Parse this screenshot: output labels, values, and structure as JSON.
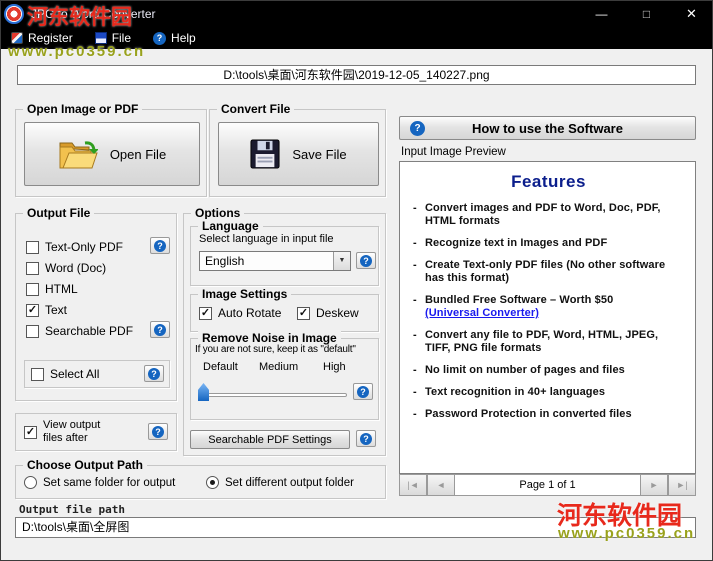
{
  "glyphs": {
    "question": "?",
    "check": "✓",
    "dropdown": "▼"
  },
  "window": {
    "title": "JPG to Word Converter",
    "minimize": "—",
    "maximize": "□",
    "close": "✕"
  },
  "menu": {
    "register": "Register",
    "file": "File",
    "help": "Help"
  },
  "watermark": {
    "site_name": "河东软件园",
    "site_url": "www.pc0359.cn"
  },
  "input_file": {
    "path": "D:\\tools\\桌面\\河东软件园\\2019-12-05_140227.png"
  },
  "open_group": {
    "title": "Open Image or PDF",
    "button_label": "Open File"
  },
  "convert_group": {
    "title": "Convert File",
    "button_label": "Save File"
  },
  "help_section": {
    "how_to_button": "How to use the Software",
    "preview_label": "Input Image Preview"
  },
  "preview": {
    "heading": "Features",
    "bullet": "-",
    "items": [
      {
        "text": "Convert images and PDF to Word, Doc, PDF, HTML formats"
      },
      {
        "text": "Recognize text in Images and PDF"
      },
      {
        "text": "Create Text-only PDF files (No other software has this format)"
      },
      {
        "text": "Bundled Free Software – Worth $50",
        "link": "(Universal Converter)"
      },
      {
        "text": "Convert any file to PDF, Word, HTML, JPEG, TIFF, PNG file formats"
      },
      {
        "text": "No limit on number of pages and files"
      },
      {
        "text": "Text recognition in 40+ languages"
      },
      {
        "text": "Password Protection in converted files"
      }
    ],
    "pagination": {
      "first": "|◄",
      "prev": "◄",
      "page_label": "Page 1 of 1",
      "next": "►",
      "last": "►|"
    }
  },
  "output_file": {
    "title": "Output File",
    "options": [
      {
        "label": "Text-Only PDF",
        "checked": false,
        "has_help": true
      },
      {
        "label": "Word (Doc)",
        "checked": false,
        "has_help": false
      },
      {
        "label": "HTML",
        "checked": false,
        "has_help": false
      },
      {
        "label": "Text",
        "checked": true,
        "has_help": false
      },
      {
        "label": "Searchable PDF",
        "checked": false,
        "has_help": true
      }
    ],
    "select_all_label": "Select All",
    "view_output_label": "View output files after"
  },
  "options": {
    "title": "Options",
    "language": {
      "title": "Language",
      "hint": "Select language in input file",
      "selected": "English"
    },
    "image_settings": {
      "title": "Image Settings",
      "auto_rotate": "Auto Rotate",
      "deskew": "Deskew"
    },
    "noise": {
      "title": "Remove Noise in Image",
      "hint": "If you are not sure, keep it as \"default\"",
      "levels": [
        "Default",
        "Medium",
        "High"
      ],
      "value": "Default"
    },
    "searchable_pdf_button": "Searchable PDF Settings"
  },
  "output_path": {
    "title": "Choose Output Path",
    "same_folder": "Set same folder for output",
    "different_folder": "Set different output folder",
    "selected": "Set different output folder",
    "field_label": "Output file path",
    "value": "D:\\tools\\桌面\\全屏图"
  }
}
